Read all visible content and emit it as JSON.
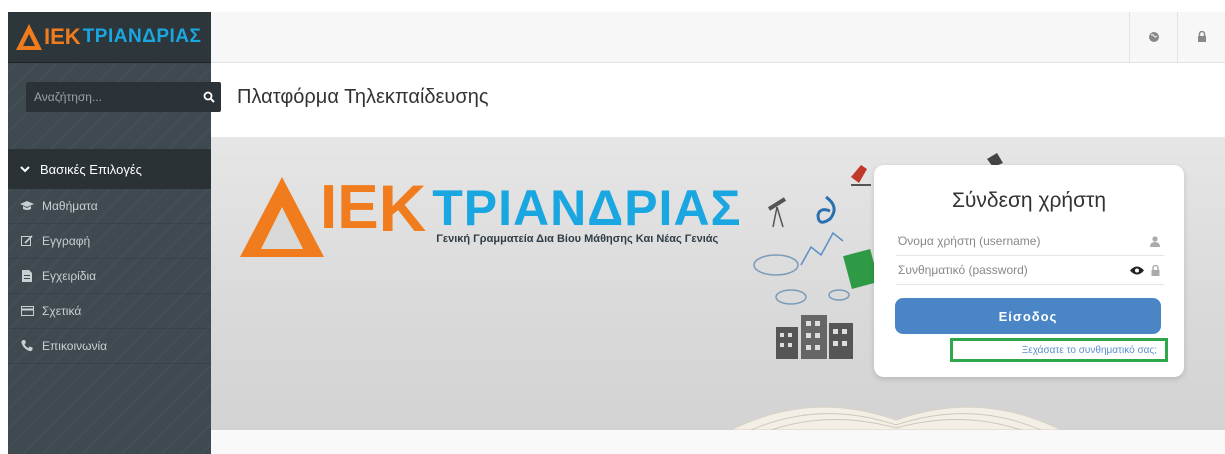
{
  "brand": {
    "logo_ie": "ΙΕ",
    "logo_k": "Κ",
    "logo_name": "ΤΡΙΑΝΔΡΙΑΣ",
    "subtitle": "Γενική Γραμματεία Δια Βίου Μάθησης Και Νέας Γενιάς",
    "orange": "#f07c1d",
    "blue": "#1aa6e0"
  },
  "search": {
    "placeholder": "Αναζήτηση..."
  },
  "sidebar": {
    "header": "Βασικές Επιλογές",
    "items": [
      {
        "label": "Μαθήματα",
        "icon": "graduation-cap-icon"
      },
      {
        "label": "Εγγραφή",
        "icon": "edit-icon"
      },
      {
        "label": "Εγχειρίδια",
        "icon": "file-icon"
      },
      {
        "label": "Σχετικά",
        "icon": "card-icon"
      },
      {
        "label": "Επικοινωνία",
        "icon": "phone-icon"
      }
    ]
  },
  "page": {
    "title": "Πλατφόρμα Τηλεκπαίδευσης"
  },
  "login": {
    "title": "Σύνδεση χρήστη",
    "username_placeholder": "Όνομα χρήστη (username)",
    "password_placeholder": "Συνθηματικό (password)",
    "submit": "Είσοδος",
    "forgot": "Ξεχάσατε το συνθηματικό σας;",
    "button_color": "#4a86c6",
    "highlight_color": "#2ea84a"
  }
}
